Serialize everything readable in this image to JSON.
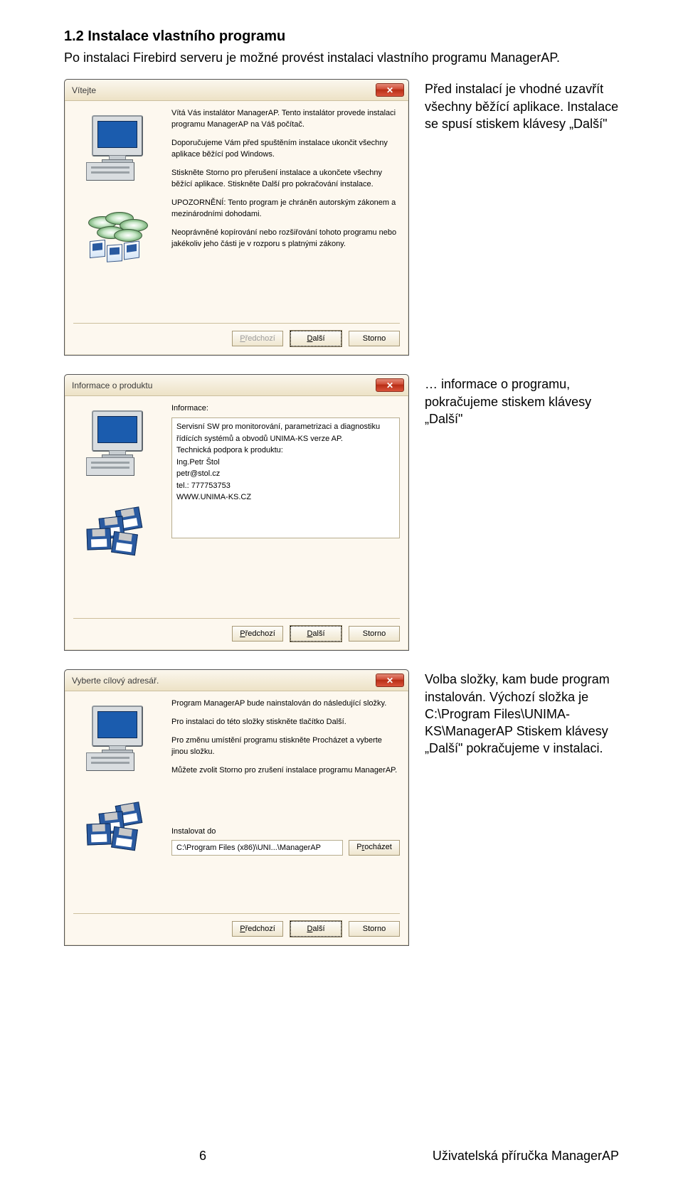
{
  "heading": "1.2 Instalace vlastního programu",
  "intro": "Po instalaci Firebird serveru je možné provést instalaci vlastního programu ManagerAP.",
  "captions": {
    "step1": "Před instalací je vhodné uzavřít všechny běžící aplikace. Instalace se spusí stiskem klávesy „Další\"",
    "step2": "… informace o programu, pokračujeme stiskem klávesy „Další\"",
    "step3": "Volba složky, kam bude program instalován. Výchozí složka je C:\\Program Files\\UNIMA-KS\\ManagerAP Stiskem klávesy „Další\" pokračujeme v instalaci."
  },
  "dialogs": {
    "d1": {
      "title": "Vítejte",
      "lines": [
        "Vítá Vás instalátor  ManagerAP. Tento instalátor provede instalaci programu  ManagerAP na Váš počítač.",
        "Doporučujeme Vám  před spuštěním instalace ukončit všechny aplikace běžící pod Windows.",
        "Stiskněte Storno pro přerušení instalace a ukončete všechny běžící aplikace. Stiskněte Další pro pokračování instalace.",
        "UPOZORNĚNÍ: Tento program je chráněn autorským zákonem a mezinárodními dohodami.",
        "Neoprávněné kopírování nebo rozšiřování tohoto programu nebo jakékoliv jeho části je v rozporu s platnými zákony."
      ]
    },
    "d2": {
      "title": "Informace o produktu",
      "label": "Informace:",
      "textbox": [
        "Servisní SW pro monitorování, parametrizaci a diagnostiku řídících systémů a obvodů UNIMA-KS verze AP.",
        "",
        "Technická podpora k produktu:",
        "",
        "Ing.Petr Štol",
        "petr@stol.cz",
        "tel.: 777753753",
        "",
        "WWW.UNIMA-KS.CZ"
      ]
    },
    "d3": {
      "title": "Vyberte cílový adresář.",
      "lines": [
        "Program ManagerAP bude nainstalován do následující složky.",
        "Pro instalaci do této složky  stiskněte tlačítko Další.",
        "Pro změnu umístění programu stiskněte Procházet a vyberte jinou složku.",
        "Můžete zvolit Storno pro zrušení instalace programu ManagerAP."
      ],
      "path_label": "Instalovat do",
      "path_value": "C:\\Program Files (x86)\\UNI...\\ManagerAP",
      "browse": "Procházet"
    },
    "buttons": {
      "prev": "Předchozí",
      "next": "Další",
      "cancel": "Storno"
    }
  },
  "footer": {
    "page": "6",
    "doc": "Uživatelská příručka ManagerAP"
  }
}
